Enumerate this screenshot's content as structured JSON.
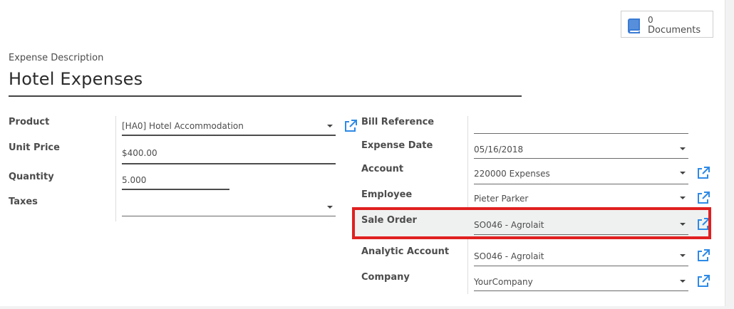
{
  "documents": {
    "count": "0",
    "label": "Documents"
  },
  "expense": {
    "description_label": "Expense Description",
    "title": "Hotel Expenses"
  },
  "left_fields": {
    "product": {
      "label": "Product",
      "value": "[HA0] Hotel Accommodation"
    },
    "unit_price": {
      "label": "Unit Price",
      "value": "$400.00"
    },
    "quantity": {
      "label": "Quantity",
      "value": "5.000"
    },
    "taxes": {
      "label": "Taxes",
      "value": ""
    }
  },
  "right_fields": {
    "bill_reference": {
      "label": "Bill Reference",
      "value": ""
    },
    "expense_date": {
      "label": "Expense Date",
      "value": "05/16/2018"
    },
    "account": {
      "label": "Account",
      "value": "220000 Expenses"
    },
    "employee": {
      "label": "Employee",
      "value": "Pieter Parker"
    },
    "sale_order": {
      "label": "Sale Order",
      "value": "SO046 - Agrolait"
    },
    "analytic_account": {
      "label": "Analytic Account",
      "value": "SO046 - Agrolait"
    },
    "company": {
      "label": "Company",
      "value": "YourCompany"
    }
  },
  "colors": {
    "link_icon": "#2e8ae6",
    "highlight": "#e02020",
    "doc_icon": "#3a7bd5"
  },
  "icons": [
    "book-icon",
    "external-link-icon",
    "caret-down-icon"
  ]
}
